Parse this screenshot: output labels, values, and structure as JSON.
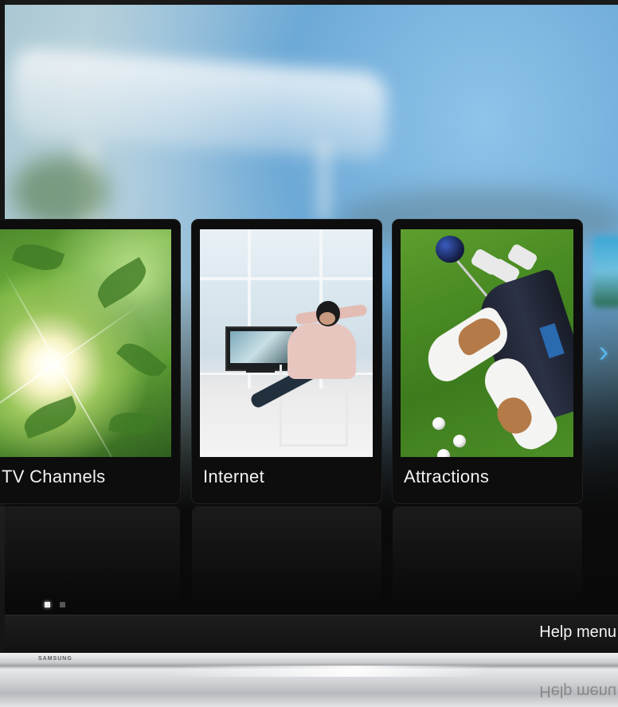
{
  "cards": [
    {
      "label": "TV Channels",
      "image": "sunlit-green-leaves"
    },
    {
      "label": "Internet",
      "image": "man-relaxing-watching-tv"
    },
    {
      "label": "Attractions",
      "image": "golf-bag-shoes-on-grass"
    }
  ],
  "navigation": {
    "next_icon": "›"
  },
  "pager": {
    "total": 2,
    "active": 1
  },
  "bottom_bar": {
    "help_label": "Help menu"
  },
  "brand": {
    "logo_text": "SAMSUNG"
  },
  "colors": {
    "accent": "#57b5e8",
    "card_bg": "#0d0d0d",
    "bar_bg": "#151515"
  }
}
